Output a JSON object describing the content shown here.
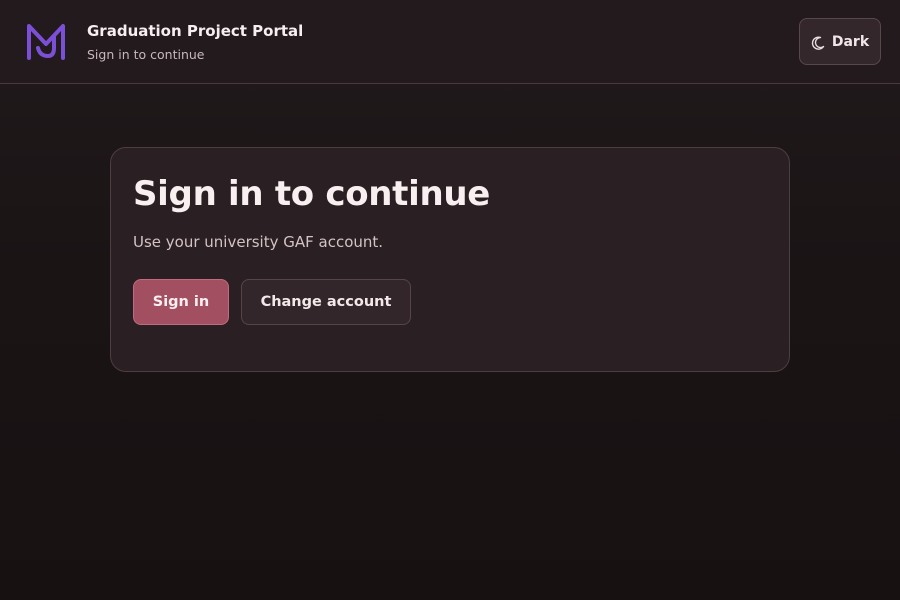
{
  "header": {
    "title": "Graduation Project Portal",
    "subtitle": "Sign in to continue",
    "logo_icon": "mj-monogram-icon",
    "theme_toggle": {
      "icon": "moon-icon",
      "label": "Dark"
    }
  },
  "card": {
    "title": "Sign in to continue",
    "description": "Use your university GAF account.",
    "primary_button": "Sign in",
    "secondary_button": "Change account"
  },
  "colors": {
    "background": "#181213",
    "header_bg": "#221a1d",
    "card_bg": "#2a1f22",
    "primary_button": "#a24f62",
    "logo": "#7b4fd6"
  }
}
